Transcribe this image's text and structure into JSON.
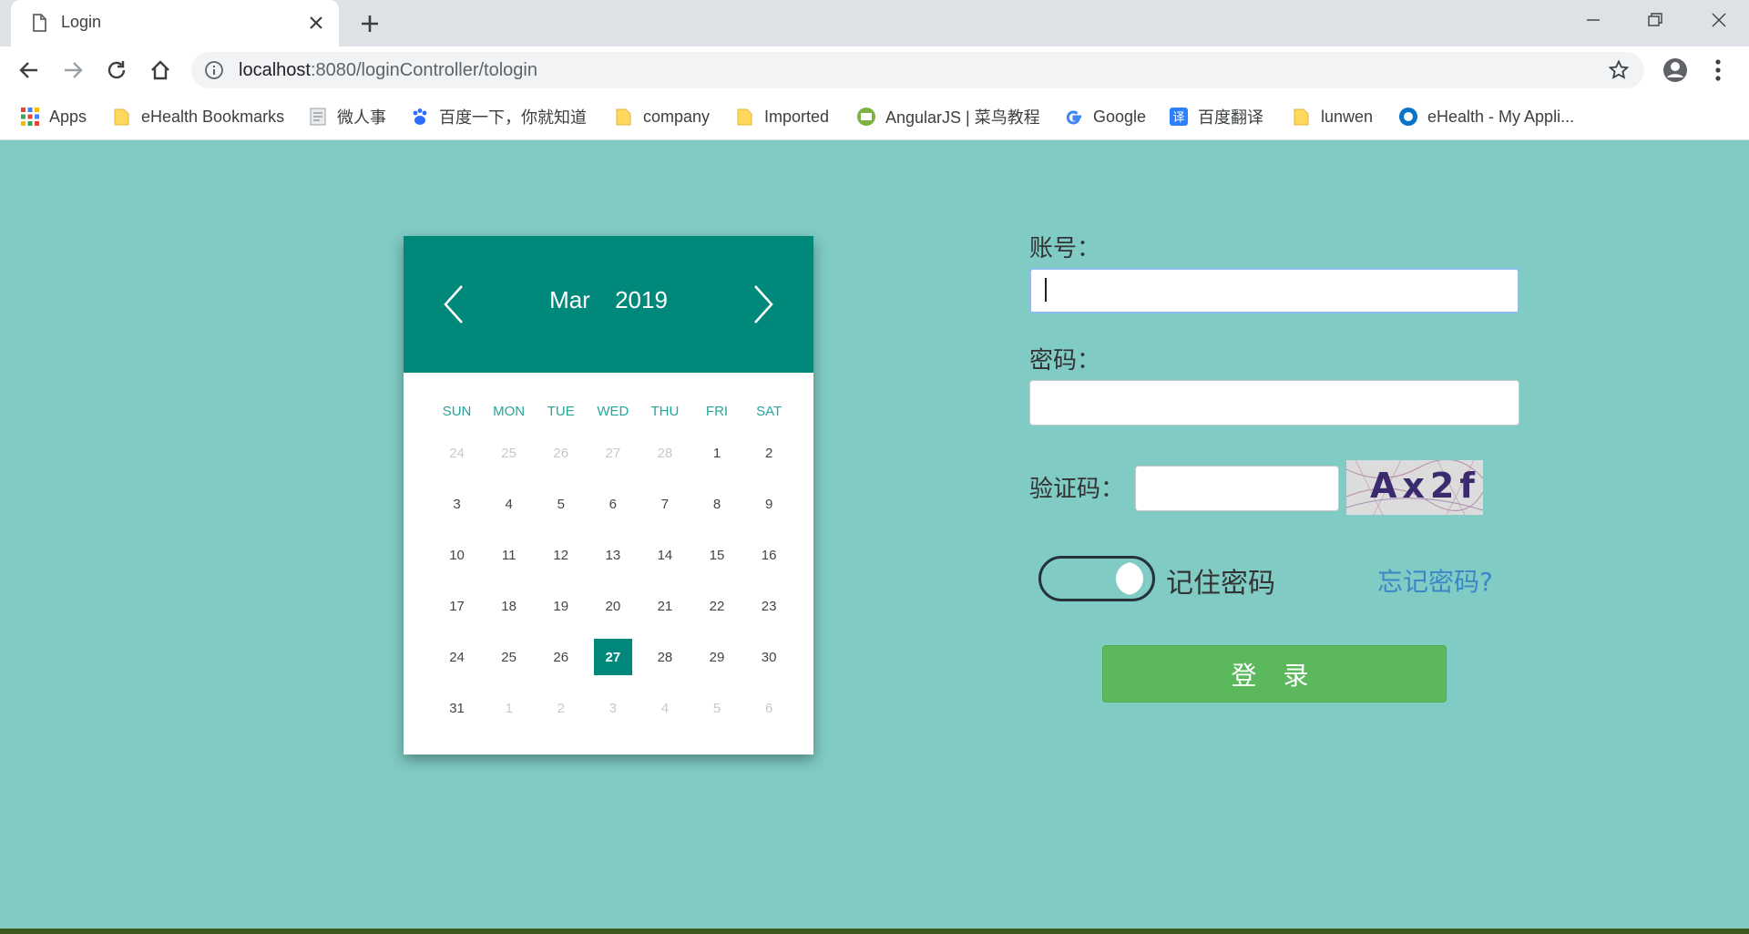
{
  "browser": {
    "tab_title": "Login",
    "url_host": "localhost",
    "url_rest": ":8080/loginController/tologin",
    "bookmarks": [
      {
        "label": "Apps",
        "icon": "apps-grid-icon"
      },
      {
        "label": "eHealth Bookmarks",
        "icon": "folder-icon"
      },
      {
        "label": "微人事",
        "icon": "doc-icon"
      },
      {
        "label": "百度一下，你就知道",
        "icon": "baidu-paw-icon"
      },
      {
        "label": "company",
        "icon": "folder-icon"
      },
      {
        "label": "Imported",
        "icon": "folder-icon"
      },
      {
        "label": "AngularJS | 菜鸟教程",
        "icon": "runoob-icon"
      },
      {
        "label": "Google",
        "icon": "google-g-icon"
      },
      {
        "label": "百度翻译",
        "icon": "baidu-translate-icon"
      },
      {
        "label": "lunwen",
        "icon": "folder-icon"
      },
      {
        "label": "eHealth - My Appli...",
        "icon": "ehealth-icon"
      }
    ]
  },
  "calendar": {
    "month": "Mar",
    "year": "2019",
    "weekdays": [
      "SUN",
      "MON",
      "TUE",
      "WED",
      "THU",
      "FRI",
      "SAT"
    ],
    "weeks": [
      [
        {
          "d": "24",
          "m": true
        },
        {
          "d": "25",
          "m": true
        },
        {
          "d": "26",
          "m": true
        },
        {
          "d": "27",
          "m": true
        },
        {
          "d": "28",
          "m": true
        },
        {
          "d": "1"
        },
        {
          "d": "2"
        }
      ],
      [
        {
          "d": "3"
        },
        {
          "d": "4"
        },
        {
          "d": "5"
        },
        {
          "d": "6"
        },
        {
          "d": "7"
        },
        {
          "d": "8"
        },
        {
          "d": "9"
        }
      ],
      [
        {
          "d": "10"
        },
        {
          "d": "11"
        },
        {
          "d": "12"
        },
        {
          "d": "13"
        },
        {
          "d": "14"
        },
        {
          "d": "15"
        },
        {
          "d": "16"
        }
      ],
      [
        {
          "d": "17"
        },
        {
          "d": "18"
        },
        {
          "d": "19"
        },
        {
          "d": "20"
        },
        {
          "d": "21"
        },
        {
          "d": "22"
        },
        {
          "d": "23"
        }
      ],
      [
        {
          "d": "24"
        },
        {
          "d": "25"
        },
        {
          "d": "26"
        },
        {
          "d": "27",
          "today": true
        },
        {
          "d": "28"
        },
        {
          "d": "29"
        },
        {
          "d": "30"
        }
      ],
      [
        {
          "d": "31"
        },
        {
          "d": "1",
          "m": true
        },
        {
          "d": "2",
          "m": true
        },
        {
          "d": "3",
          "m": true
        },
        {
          "d": "4",
          "m": true
        },
        {
          "d": "5",
          "m": true
        },
        {
          "d": "6",
          "m": true
        }
      ]
    ]
  },
  "form": {
    "account_label": "账号：",
    "account_value": "",
    "password_label": "密码：",
    "password_value": "",
    "captcha_label": "验证码：",
    "captcha_value": "",
    "captcha_text": "Ax2f",
    "remember_label": "记住密码",
    "forgot_label": "忘记密码?",
    "login_label": "登 录"
  },
  "colors": {
    "page_bg": "#80cbc4",
    "calendar_header": "#00897b",
    "login_button": "#5cb85c",
    "link": "#3a87c8"
  }
}
